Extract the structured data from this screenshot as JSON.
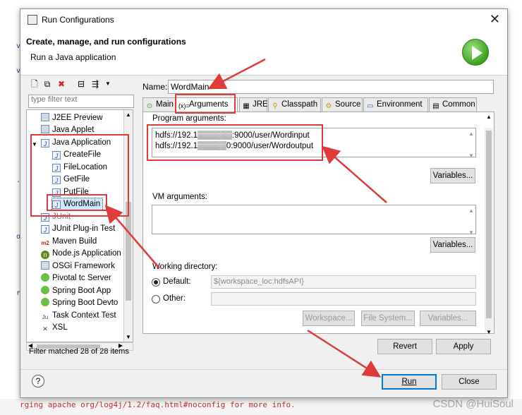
{
  "window": {
    "title": "Run Configurations"
  },
  "banner": {
    "title": "Create, manage, and run configurations",
    "subtitle": "Run a Java application"
  },
  "filter": {
    "placeholder": "type filter text"
  },
  "tree": {
    "items": [
      {
        "label": "J2EE Preview",
        "icon": "j2ee-icon"
      },
      {
        "label": "Java Applet",
        "icon": "applet-icon"
      },
      {
        "label": "Java Application",
        "icon": "java-app-icon"
      },
      {
        "label": "CreateFile",
        "icon": "java-doc-icon"
      },
      {
        "label": "FileLocation",
        "icon": "java-doc-icon"
      },
      {
        "label": "GetFile",
        "icon": "java-doc-icon"
      },
      {
        "label": "PutFile",
        "icon": "java-doc-icon"
      },
      {
        "label": "WordMain",
        "icon": "java-doc-icon"
      },
      {
        "label": "JUnit",
        "icon": "junit-icon"
      },
      {
        "label": "JUnit Plug-in Test",
        "icon": "junit-plugin-icon"
      },
      {
        "label": "Maven Build",
        "icon": "maven-icon"
      },
      {
        "label": "Node.js Application",
        "icon": "nodejs-icon"
      },
      {
        "label": "OSGi Framework",
        "icon": "osgi-icon"
      },
      {
        "label": "Pivotal tc Server",
        "icon": "pivotal-icon"
      },
      {
        "label": "Spring Boot App",
        "icon": "spring-icon"
      },
      {
        "label": "Spring Boot Devto",
        "icon": "spring-icon"
      },
      {
        "label": "Task Context Test",
        "icon": "task-icon"
      },
      {
        "label": "XSL",
        "icon": "xsl-icon"
      }
    ],
    "status": "Filter matched 28 of 28 items"
  },
  "name": {
    "label": "Name:",
    "value": "WordMain"
  },
  "tabs": [
    {
      "label": "Main",
      "icon": "main-tab-icon"
    },
    {
      "label": "Arguments",
      "icon": "arguments-tab-icon"
    },
    {
      "label": "JRE",
      "icon": "jre-tab-icon"
    },
    {
      "label": "Classpath",
      "icon": "classpath-tab-icon"
    },
    {
      "label": "Source",
      "icon": "source-tab-icon"
    },
    {
      "label": "Environment",
      "icon": "environment-tab-icon"
    },
    {
      "label": "Common",
      "icon": "common-tab-icon"
    }
  ],
  "arguments": {
    "program_label": "Program arguments:",
    "program_lines": [
      "hdfs://192.1▒▒▒▒▒▒:9000/user/Wordinput",
      "hdfs://192.1▒▒▒▒▒0:9000/user/Wordoutput"
    ],
    "variables_label": "Variables...",
    "vm_label": "VM arguments:",
    "vm_variables_label": "Variables...",
    "workdir_label": "Working directory:",
    "default_label": "Default:",
    "default_value": "${workspace_loc:hdfsAPI}",
    "other_label": "Other:",
    "workspace_btn": "Workspace...",
    "filesystem_btn": "File System...",
    "variables_btn": "Variables..."
  },
  "buttons": {
    "revert": "Revert",
    "apply": "Apply",
    "run": "Run",
    "close": "Close"
  },
  "background": {
    "console": "rging apache org/log4j/1.2/faq.html#noconfig for more info.",
    "watermark": "CSDN @HuiSoul"
  },
  "colors": {
    "annotation": "#e03b3b",
    "selection": "#cde8ff"
  }
}
